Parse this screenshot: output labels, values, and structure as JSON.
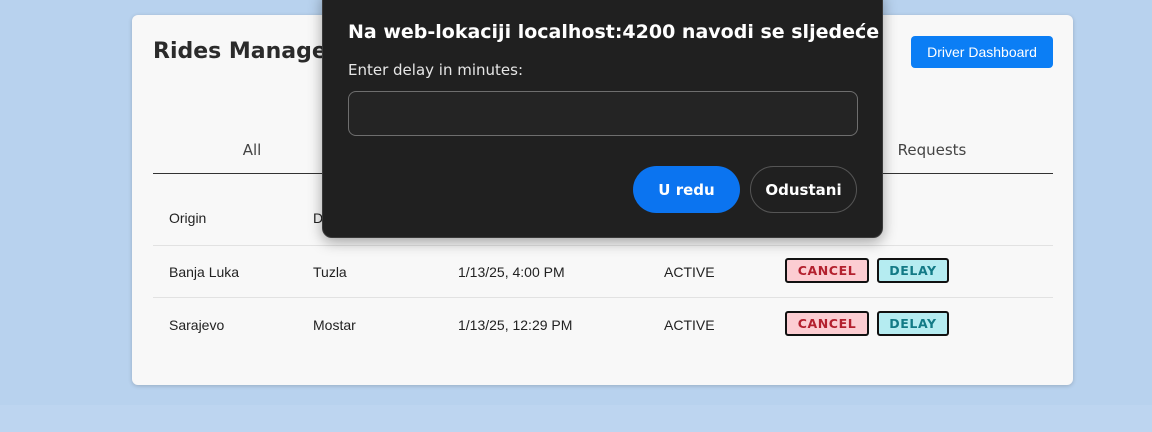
{
  "page": {
    "title": "Rides Management",
    "dashboard_button": "Driver Dashboard"
  },
  "tabs": {
    "all": "All",
    "requests": "Requests"
  },
  "table": {
    "header_origin": "Origin",
    "header_destination_partial": "D",
    "rows": [
      {
        "origin": "Banja Luka",
        "destination": "Tuzla",
        "time": "1/13/25, 4:00 PM",
        "status": "ACTIVE",
        "cancel": "CANCEL",
        "delay": "DELAY"
      },
      {
        "origin": "Sarajevo",
        "destination": "Mostar",
        "time": "1/13/25, 12:29 PM",
        "status": "ACTIVE",
        "cancel": "CANCEL",
        "delay": "DELAY"
      }
    ]
  },
  "dialog": {
    "title": "Na web-lokaciji localhost:4200 navodi se sljedeće",
    "message": "Enter delay in minutes:",
    "input_value": "",
    "ok_label": "U redu",
    "cancel_label": "Odustani"
  },
  "colors": {
    "background": "#b8d2ee",
    "primary": "#0b7ef5",
    "cancel_bg": "#fccdd2",
    "cancel_text": "#b3202e",
    "delay_bg": "#b5ecf1",
    "delay_text": "#127a86",
    "dialog_bg": "#202020"
  }
}
